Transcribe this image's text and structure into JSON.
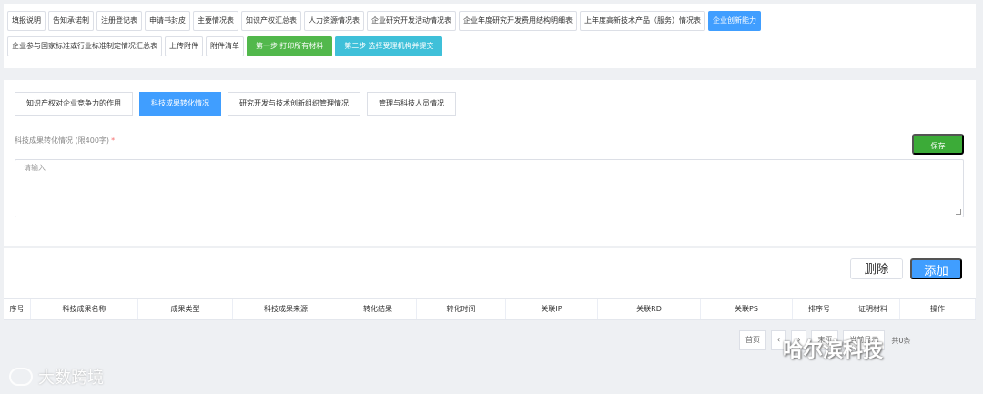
{
  "top_nav": {
    "row1": [
      {
        "label": "填报说明",
        "active": false
      },
      {
        "label": "告知承诺制",
        "active": false
      },
      {
        "label": "注册登记表",
        "active": false
      },
      {
        "label": "申请书封皮",
        "active": false
      },
      {
        "label": "主要情况表",
        "active": false
      },
      {
        "label": "知识产权汇总表",
        "active": false
      },
      {
        "label": "人力资源情况表",
        "active": false
      },
      {
        "label": "企业研究开发活动情况表",
        "active": false
      },
      {
        "label": "企业年度研究开发费用结构明细表",
        "active": false
      },
      {
        "label": "上年度高新技术产品（服务）情况表",
        "active": false
      },
      {
        "label": "企业创新能力",
        "active": true
      }
    ],
    "row2": [
      {
        "label": "企业参与国家标准或行业标准制定情况汇总表"
      },
      {
        "label": "上传附件"
      },
      {
        "label": "附件清单"
      }
    ],
    "step1_label": "第一步 打印所有材料",
    "step2_label": "第二步 选择受理机构并提交"
  },
  "tabs": [
    {
      "label": "知识产权对企业竞争力的作用",
      "active": false
    },
    {
      "label": "科技成果转化情况",
      "active": true
    },
    {
      "label": "研究开发与技术创新组织管理情况",
      "active": false
    },
    {
      "label": "管理与科技人员情况",
      "active": false
    }
  ],
  "form": {
    "field_label": "科技成果转化情况 (限400字)",
    "required_mark": "*",
    "placeholder": "请输入",
    "save_label": "保存"
  },
  "list": {
    "delete_label": "删除",
    "add_label": "添加",
    "columns": [
      "序号",
      "科技成果名称",
      "成果类型",
      "科技成果来源",
      "转化结果",
      "转化时间",
      "关联IP",
      "关联RD",
      "关联PS",
      "排序号",
      "证明材料",
      "操作"
    ]
  },
  "pager": {
    "first_label": "首页",
    "prev_label": "‹",
    "next_label": "›",
    "last_label": "末页",
    "current_label": "当前显示",
    "total_label": "共0条"
  },
  "watermarks": {
    "left": "大数跨境",
    "right": "哈尔滨科技"
  }
}
